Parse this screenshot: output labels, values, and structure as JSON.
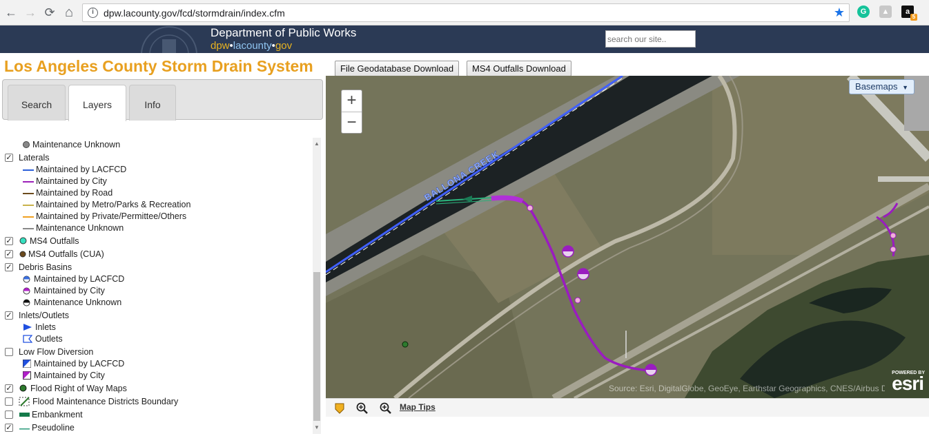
{
  "browser": {
    "url": "dpw.lacounty.gov/fcd/stormdrain/index.cfm",
    "nav_back": "←",
    "nav_forward": "→",
    "nav_reload": "⟳",
    "nav_home": "⌂",
    "star": "★",
    "ext_amazon_badge": "5"
  },
  "site_header": {
    "department": "Department of Public Works",
    "url_part1": "dpw",
    "url_part2": "lacounty",
    "url_part3": "gov",
    "search_placeholder": "search our site.."
  },
  "app": {
    "title": "Los Angeles County Storm Drain System",
    "download_gdb": "File Geodatabase Download",
    "download_ms4": "MS4 Outfalls Download"
  },
  "tabs": [
    {
      "label": "Search"
    },
    {
      "label": "Layers"
    },
    {
      "label": "Info"
    }
  ],
  "layers": {
    "maintenance_unknown_top": "Maintenance Unknown",
    "laterals": {
      "label": "Laterals",
      "checked": true,
      "items": [
        {
          "label": "Maintained by LACFCD",
          "color": "#2b5fd9"
        },
        {
          "label": "Maintained by City",
          "color": "#9b1fb8"
        },
        {
          "label": "Maintained by Road",
          "color": "#6b4a1c"
        },
        {
          "label": "Maintained by Metro/Parks & Recreation",
          "color": "#c8b24a"
        },
        {
          "label": "Maintained by Private/Permittee/Others",
          "color": "#f0a020"
        },
        {
          "label": "Maintenance Unknown",
          "color": "#888888"
        }
      ]
    },
    "ms4_outfalls": {
      "label": "MS4 Outfalls",
      "checked": true
    },
    "ms4_outfalls_cua": {
      "label": "MS4 Outfalls (CUA)",
      "checked": true
    },
    "debris_basins": {
      "label": "Debris Basins",
      "checked": true,
      "items": [
        {
          "label": "Maintained by LACFCD"
        },
        {
          "label": "Maintained by City"
        },
        {
          "label": "Maintenance Unknown"
        }
      ]
    },
    "inlets_outlets": {
      "label": "Inlets/Outlets",
      "checked": true,
      "items": [
        {
          "label": "Inlets"
        },
        {
          "label": "Outlets"
        }
      ]
    },
    "low_flow": {
      "label": "Low Flow Diversion",
      "checked": false,
      "items": [
        {
          "label": "Maintained by LACFCD"
        },
        {
          "label": "Maintained by City"
        }
      ]
    },
    "flood_row": {
      "label": "Flood Right of Way Maps",
      "checked": true
    },
    "flood_districts": {
      "label": "Flood Maintenance Districts Boundary",
      "checked": false
    },
    "embankment": {
      "label": "Embankment",
      "checked": false
    },
    "pseudoline": {
      "label": "Pseudoline",
      "checked": true
    }
  },
  "map": {
    "zoom_in": "+",
    "zoom_out": "−",
    "basemaps_label": "Basemaps",
    "channel_label": "BALLONA CREEK",
    "attribution": "Source: Esri, DigitalGlobe, GeoEye, Earthstar Geographics, CNES/Airbus DS",
    "esri_powered": "POWERED BY",
    "esri_brand": "esri"
  },
  "map_tools": {
    "map_tips": "Map Tips"
  }
}
